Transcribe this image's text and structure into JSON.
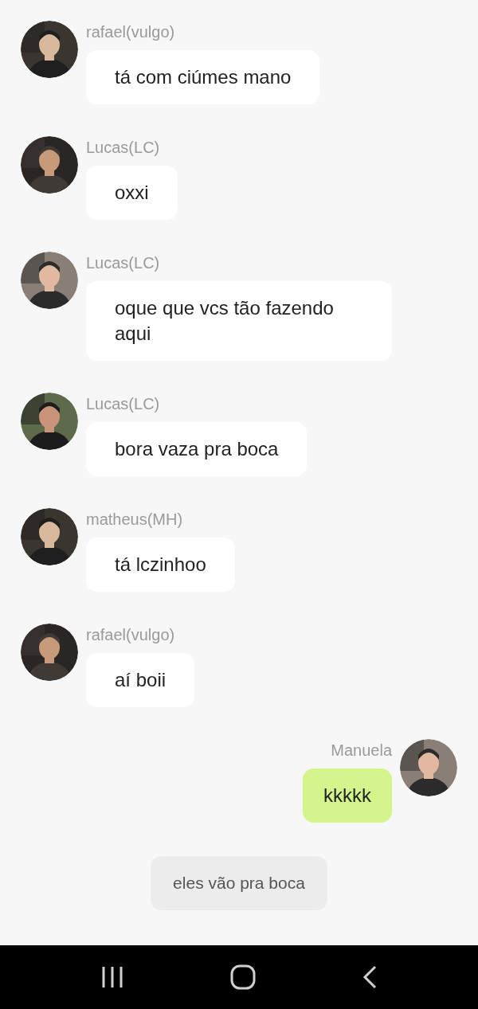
{
  "messages": [
    {
      "kind": "incoming",
      "sender": "rafael(vulgo)",
      "text": "tá com ciúmes mano"
    },
    {
      "kind": "incoming",
      "sender": "Lucas(LC)",
      "text": "oxxi"
    },
    {
      "kind": "incoming",
      "sender": "Lucas(LC)",
      "text": "oque que vcs tão fazendo aqui"
    },
    {
      "kind": "incoming",
      "sender": "Lucas(LC)",
      "text": "bora vaza pra boca"
    },
    {
      "kind": "incoming",
      "sender": "matheus(MH)",
      "text": "tá lczinhoo"
    },
    {
      "kind": "incoming",
      "sender": "rafael(vulgo)",
      "text": "aí boii"
    },
    {
      "kind": "outgoing",
      "sender": "Manuela",
      "text": "kkkkk"
    },
    {
      "kind": "system",
      "text": "eles vão pra boca"
    }
  ]
}
